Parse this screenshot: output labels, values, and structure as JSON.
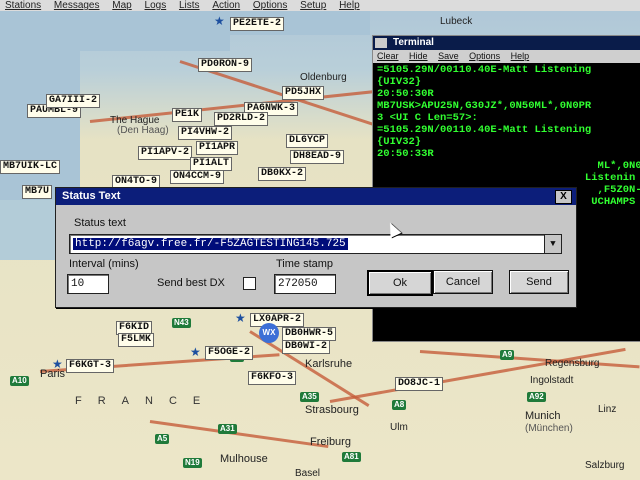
{
  "menubar": [
    "Stations",
    "Messages",
    "Map",
    "Logs",
    "Lists",
    "Action",
    "Options",
    "Setup",
    "Help"
  ],
  "map": {
    "callsigns": [
      "PE2ETE-2",
      "PD0RON-9",
      "PD5JHX",
      "PA6NWK-3",
      "PAUMBL-9",
      "GA7III-2",
      "PE1K",
      "PD2RLD-2",
      "PI4VHW-2",
      "DL6YCP",
      "PI1APV-2",
      "PI1APR",
      "DH8EAD-9",
      "MB7UIK-LC",
      "PI1ALT",
      "DB0KX-2",
      "ON4TO-9",
      "ON4CCM-9",
      "MB7U",
      "LX0APR-2",
      "F6KID",
      "F5LMK",
      "DB0HWR-5",
      "DB0WI-2",
      "F5OGE-2",
      "F6KGT-3",
      "F6KFO-3",
      "DO8JC-1",
      "DB0JC"
    ],
    "cities": [
      "Lubeck",
      "Oldenburg",
      "The Hague",
      "(Den Haag)",
      "Karlsruhe",
      "Paris",
      "Strasbourg",
      "Regensburg",
      "Ingolstadt",
      "Munich",
      "(München)",
      "Ulm",
      "Linz",
      "Freiburg",
      "Mulhouse",
      "Basel",
      "Salzburg"
    ],
    "country": "FRANCE",
    "roads": [
      "N43",
      "A4",
      "A10",
      "A5",
      "A31",
      "N19",
      "A35",
      "A8",
      "A92",
      "A9",
      "A81"
    ],
    "wx_badge": "WX"
  },
  "terminal": {
    "title": "Terminal",
    "menu": [
      "Clear",
      "Hide",
      "Save",
      "Options",
      "Help"
    ],
    "lines": [
      "=5105.29N/00110.40E-Matt Listening",
      "{UIV32}",
      "20:50:30R",
      "MB7USK>APU25N,G30JZ*,0N50ML*,0N0PR",
      "3 <UI C Len=57>:",
      "=5105.29N/00110.40E-Matt Listening",
      "{UIV32}",
      "20:50:33R",
      "",
      "                                   ML*,0N0R",
      "",
      "                                 Listenin",
      "",
      "",
      "                                   ,F5Z0N-3",
      "",
      "",
      "                                  UCHAMPS"
    ]
  },
  "dialog": {
    "title": "Status Text",
    "close_label": "X",
    "status_label": "Status text",
    "status_value": "http://f6agv.free.fr/-F5ZAGTESTING145.725",
    "interval_label": "Interval (mins)",
    "interval_value": "10",
    "send_best_dx_label": "Send best DX",
    "send_best_dx_checked": false,
    "timestamp_label": "Time stamp",
    "timestamp_value": "272050",
    "ok_label": "Ok",
    "cancel_label": "Cancel",
    "send_label": "Send"
  }
}
